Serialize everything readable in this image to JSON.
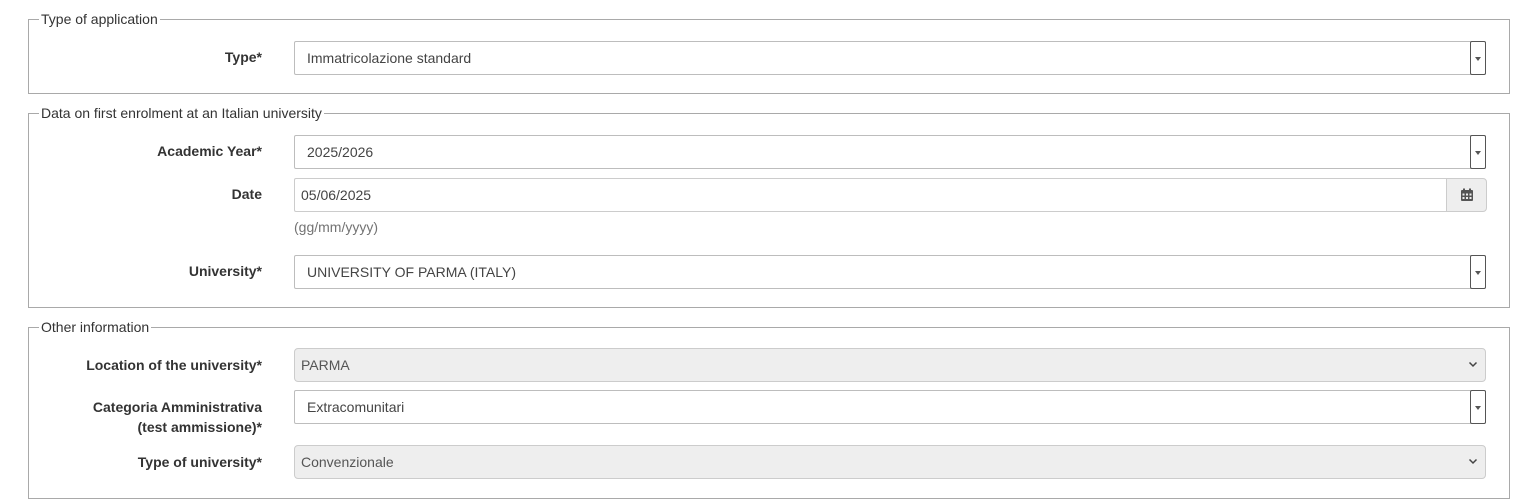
{
  "type_section": {
    "legend": "Type of application",
    "type_label": "Type*",
    "type_value": "Immatricolazione standard"
  },
  "first_enrolment": {
    "legend": "Data on first enrolment at an Italian university",
    "academic_year_label": "Academic Year*",
    "academic_year_value": "2025/2026",
    "date_label": "Date",
    "date_value": "05/06/2025",
    "date_hint": "(gg/mm/yyyy)",
    "university_label": "University*",
    "university_value": "UNIVERSITY OF PARMA (ITALY)"
  },
  "other_info": {
    "legend": "Other information",
    "location_label": "Location of the university*",
    "location_value": "PARMA",
    "categoria_label_line1": "Categoria Amministrativa",
    "categoria_label_line2": "(test ammissione)*",
    "categoria_value": "Extracomunitari",
    "type_university_label": "Type of university*",
    "type_university_value": "Convenzionale"
  },
  "icons": {
    "dropdown": "caret-down-icon",
    "select": "chevron-down-icon",
    "calendar": "calendar-icon"
  }
}
